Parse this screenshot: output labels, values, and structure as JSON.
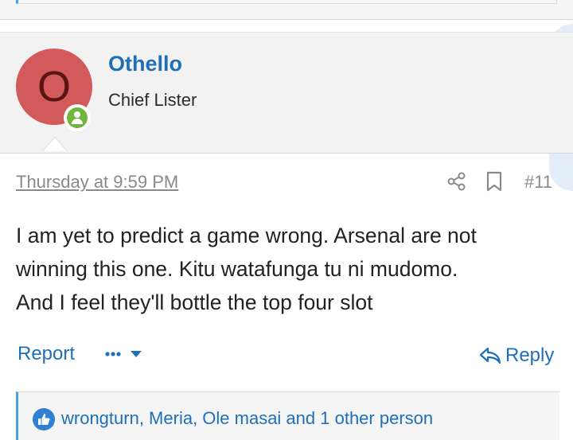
{
  "post": {
    "avatar_letter": "O",
    "username": "Othello",
    "user_title": "Chief Lister",
    "date": "Thursday at 9:59 PM",
    "number": "#11",
    "body_lines": [
      "I am yet to predict a game wrong. Arsenal are not",
      "winning this one. Kitu watafunga tu ni mudomo.",
      "And I feel they'll bottle the top four slot"
    ],
    "report_label": "Report",
    "reply_label": "Reply",
    "reactions_text": "wrongturn, Meria, Ole masai and 1 other person"
  },
  "icons": {
    "online": "user-online-icon",
    "share": "share-icon",
    "bookmark": "bookmark-icon",
    "more": "more-options-icon",
    "reply": "reply-arrow-icon",
    "like": "thumbs-up-icon"
  },
  "colors": {
    "accent": "#1f6fb8",
    "avatar_bg": "#d35a5a",
    "online": "#6fb53e",
    "quote_bar": "#4a9fe0"
  }
}
